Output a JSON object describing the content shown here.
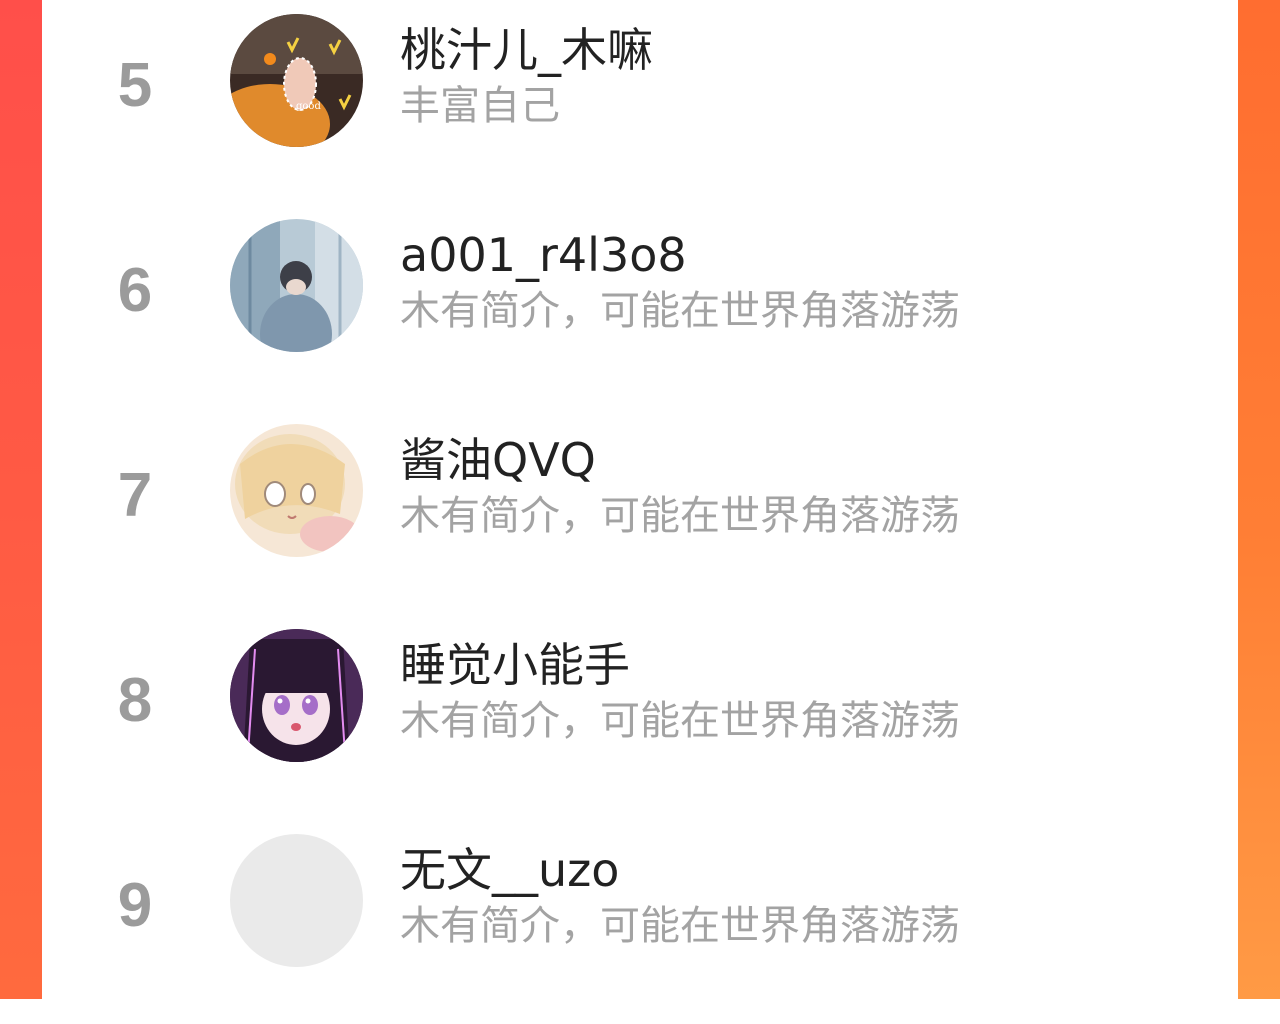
{
  "colors": {
    "accent_left": "#ff5448",
    "accent_right": "#ff7a34",
    "rank_text": "#9b9b9b",
    "name_text": "#222222",
    "bio_text": "#a3a3a3"
  },
  "users": [
    {
      "rank": "5",
      "name": "桃汁儿_木嘛",
      "bio": "丰富自己",
      "avatar_icon": "avatar-photo-orange-hand"
    },
    {
      "rank": "6",
      "name": "a001_r4l3o8",
      "bio": "木有简介，可能在世界角落游荡",
      "avatar_icon": "avatar-photo-blue-figure"
    },
    {
      "rank": "7",
      "name": "酱油QVQ",
      "bio": "木有简介，可能在世界角落游荡",
      "avatar_icon": "avatar-anime-blonde"
    },
    {
      "rank": "8",
      "name": "睡觉小能手",
      "bio": "木有简介，可能在世界角落游荡",
      "avatar_icon": "avatar-anime-purple"
    },
    {
      "rank": "9",
      "name": "无文__uzo",
      "bio": "木有简介，可能在世界角落游荡",
      "avatar_icon": "avatar-placeholder"
    }
  ]
}
